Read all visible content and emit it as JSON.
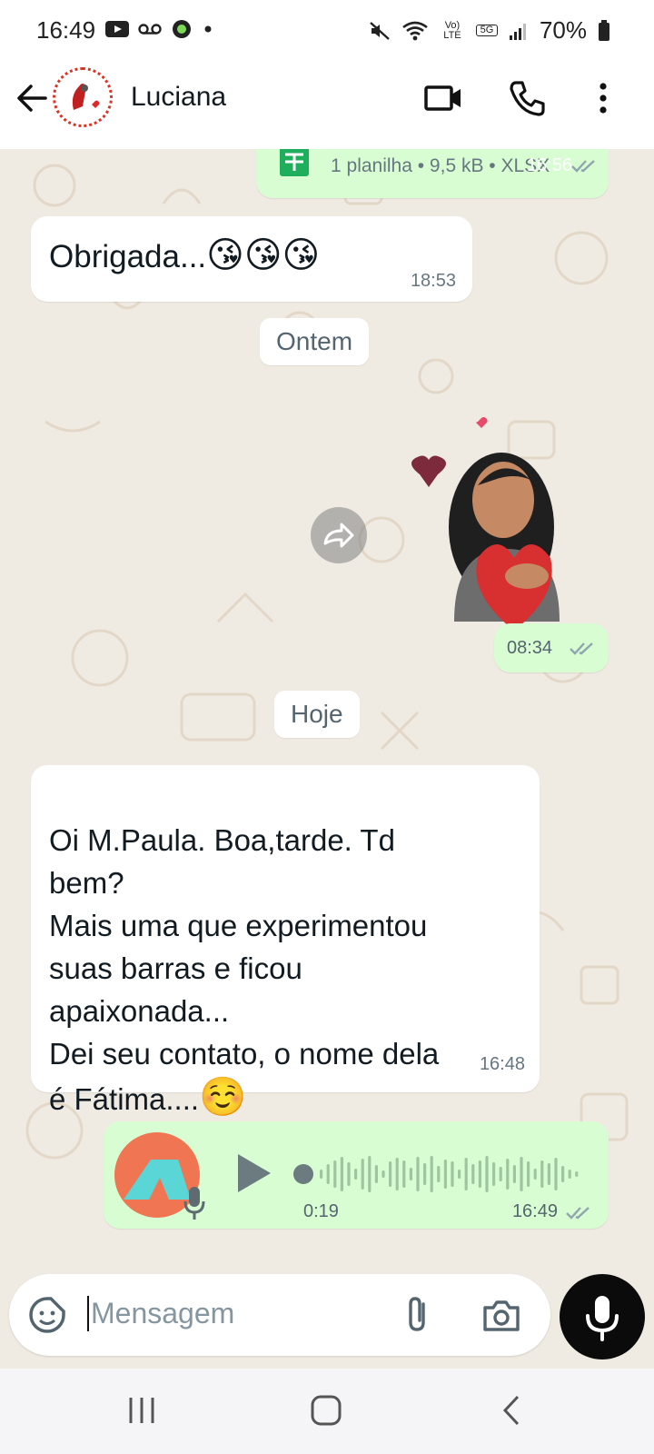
{
  "status_bar": {
    "time": "16:49",
    "network_label": "Vo) LTE",
    "network_5g": "5G",
    "battery": "70%"
  },
  "header": {
    "contact_name": "Luciana"
  },
  "messages": {
    "prev_file": {
      "info": "1 planilha • 9,5 kB • XLSX",
      "time": "16:56"
    },
    "msg1": {
      "text": "Obrigada...",
      "emojis": "😘😘😘",
      "time": "18:53"
    },
    "date1": "Ontem",
    "sticker_time": "08:34",
    "date2": "Hoje",
    "msg2": {
      "text": "Oi M.Paula. Boa,tarde. Td\nbem?\nMais uma que experimentou\nsuas barras e ficou\napaixonada...\nDei seu contato, o nome dela\né Fátima....",
      "emoji": "☺️",
      "time": "16:48"
    },
    "voice": {
      "duration": "0:19",
      "time": "16:49"
    }
  },
  "input": {
    "placeholder": "Mensagem"
  },
  "colors": {
    "outgoing_bubble": "#d9fdd3",
    "incoming_bubble": "#ffffff",
    "background": "#efeae2",
    "read_check": "#8fa6ad",
    "voice_avatar_bg": "#f07552",
    "voice_avatar_tent": "#5ad6d6"
  }
}
